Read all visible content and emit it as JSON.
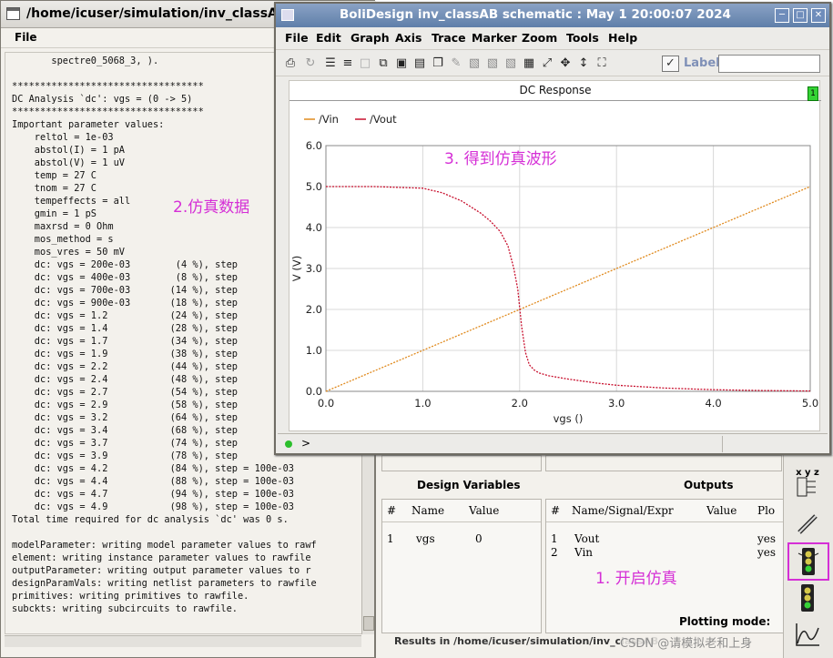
{
  "log_window": {
    "title": "/home/icuser/simulation/inv_classAB",
    "menu_file": "File",
    "lines": [
      "       spectre0_5068_3, ).",
      "",
      "**********************************",
      "DC Analysis `dc': vgs = (0 -> 5)",
      "**********************************",
      "Important parameter values:",
      "    reltol = 1e-03",
      "    abstol(I) = 1 pA",
      "    abstol(V) = 1 uV",
      "    temp = 27 C",
      "    tnom = 27 C",
      "    tempeffects = all",
      "    gmin = 1 pS",
      "    maxrsd = 0 Ohm",
      "    mos_method = s",
      "    mos_vres = 50 mV",
      "    dc: vgs = 200e-03        (4 %), step",
      "    dc: vgs = 400e-03        (8 %), step",
      "    dc: vgs = 700e-03       (14 %), step",
      "    dc: vgs = 900e-03       (18 %), step",
      "    dc: vgs = 1.2           (24 %), step",
      "    dc: vgs = 1.4           (28 %), step",
      "    dc: vgs = 1.7           (34 %), step",
      "    dc: vgs = 1.9           (38 %), step",
      "    dc: vgs = 2.2           (44 %), step",
      "    dc: vgs = 2.4           (48 %), step",
      "    dc: vgs = 2.7           (54 %), step",
      "    dc: vgs = 2.9           (58 %), step",
      "    dc: vgs = 3.2           (64 %), step",
      "    dc: vgs = 3.4           (68 %), step",
      "    dc: vgs = 3.7           (74 %), step",
      "    dc: vgs = 3.9           (78 %), step",
      "    dc: vgs = 4.2           (84 %), step = 100e-03",
      "    dc: vgs = 4.4           (88 %), step = 100e-03",
      "    dc: vgs = 4.7           (94 %), step = 100e-03",
      "    dc: vgs = 4.9           (98 %), step = 100e-03",
      "Total time required for dc analysis `dc' was 0 s.",
      "",
      "modelParameter: writing model parameter values to rawf",
      "element: writing instance parameter values to rawfile",
      "outputParameter: writing output parameter values to r",
      "designParamVals: writing netlist parameters to rawfile",
      "primitives: writing primitives to rawfile.",
      "subckts: writing subcircuits to rawfile."
    ]
  },
  "annotations": {
    "sim_data": "2.仿真数据",
    "waveform": "3. 得到仿真波形",
    "start_sim": "1. 开启仿真"
  },
  "plot_window": {
    "title": "BoliDesign inv_classAB schematic : May  1 20:00:07 2024",
    "menu": [
      "File",
      "Edit",
      "Graph",
      "Axis",
      "Trace",
      "Marker",
      "Zoom",
      "Tools",
      "Help"
    ],
    "label_text": "Label",
    "subwindow_badge": "1",
    "prompt": ">"
  },
  "ade": {
    "design_variables_header": "Design Variables",
    "outputs_header": "Outputs",
    "var_columns": [
      "#",
      "Name",
      "Value"
    ],
    "variables": [
      {
        "num": "1",
        "name": "vgs",
        "value": "0"
      }
    ],
    "out_columns": [
      "#",
      "Name/Signal/Expr",
      "Value",
      "Plo"
    ],
    "outputs": [
      {
        "num": "1",
        "name": "Vout",
        "value": "",
        "plot": "yes"
      },
      {
        "num": "2",
        "name": "Vin",
        "value": "",
        "plot": "yes"
      }
    ],
    "plotting_mode": "Plotting mode:",
    "results_text": "Results in /home/icuser/simulation/inv_classAB",
    "watermark": "CSDN @请模拟老和上身"
  },
  "chart_data": {
    "type": "line",
    "title": "DC Response",
    "xlabel": "vgs ()",
    "ylabel": "V (V)",
    "xlim": [
      0,
      5
    ],
    "ylim": [
      0,
      6
    ],
    "xticks": [
      "0.0",
      "1.0",
      "2.0",
      "3.0",
      "4.0",
      "5.0"
    ],
    "yticks": [
      "0.0",
      "1.0",
      "2.0",
      "3.0",
      "4.0",
      "5.0",
      "6.0"
    ],
    "grid": true,
    "legend_position": "top-left",
    "series": [
      {
        "name": "/Vin",
        "color": "#e08a1e",
        "x": [
          0,
          5
        ],
        "y": [
          0,
          5
        ]
      },
      {
        "name": "/Vout",
        "color": "#c8102e",
        "x": [
          0,
          0.5,
          1.0,
          1.2,
          1.4,
          1.6,
          1.7,
          1.8,
          1.88,
          1.94,
          1.98,
          2.02,
          2.06,
          2.1,
          2.15,
          2.2,
          2.3,
          2.5,
          2.8,
          3.0,
          3.5,
          4.0,
          4.5,
          5.0
        ],
        "y": [
          5.0,
          5.0,
          4.96,
          4.85,
          4.65,
          4.35,
          4.15,
          3.9,
          3.55,
          3.0,
          2.5,
          1.6,
          0.95,
          0.65,
          0.52,
          0.45,
          0.38,
          0.3,
          0.2,
          0.15,
          0.08,
          0.04,
          0.02,
          0.01
        ]
      }
    ]
  }
}
